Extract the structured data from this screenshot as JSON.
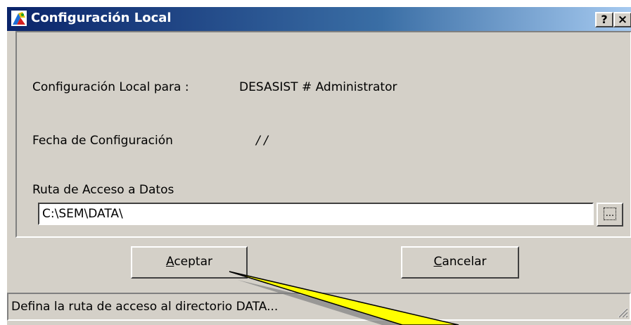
{
  "window": {
    "title": "Configuración Local",
    "help_label": "?",
    "close_label": "×"
  },
  "form": {
    "local_config_label": "Configuración Local para :",
    "local_config_value": "DESASIST # Administrator",
    "date_label": "Fecha de Configuración",
    "date_value": "/ /",
    "path_label": "Ruta de Acceso a Datos",
    "path_value": "C:\\SEM\\DATA\\",
    "browse_label": "..."
  },
  "buttons": {
    "accept_accel": "A",
    "accept_rest": "ceptar",
    "cancel_accel": "C",
    "cancel_rest": "ancelar"
  },
  "status": {
    "text": "Defina la ruta de acceso al directorio DATA..."
  },
  "colors": {
    "titlebar_start": "#0a246a",
    "titlebar_end": "#a6caf0",
    "face": "#d4d0c8",
    "callout_fill": "#ffff00"
  },
  "icons": [
    "app-icon",
    "help-icon",
    "close-icon",
    "resize-grip-icon"
  ]
}
